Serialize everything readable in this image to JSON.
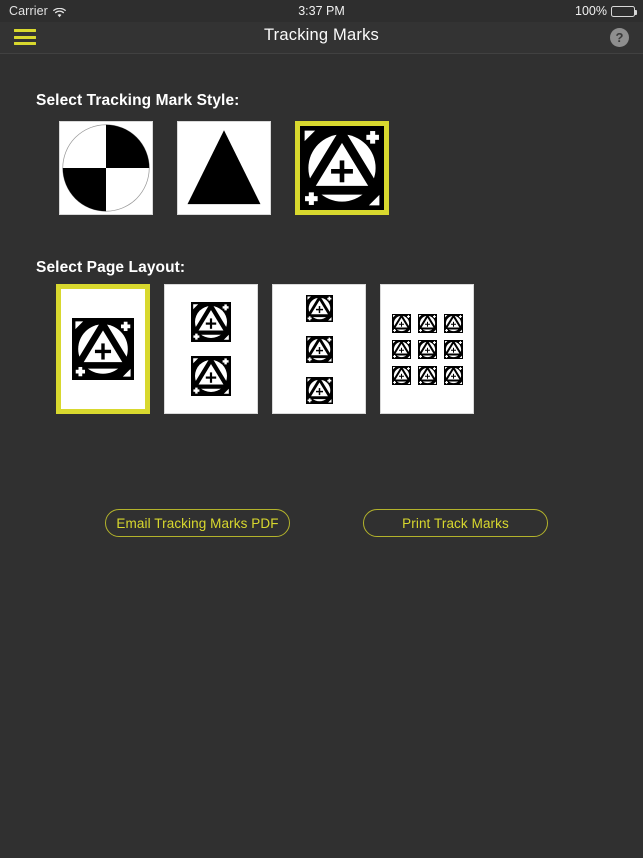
{
  "status_bar": {
    "carrier": "Carrier",
    "wifi_icon": "wifi-icon",
    "time": "3:37 PM",
    "battery_percent": "100%",
    "battery_icon": "battery-full-icon"
  },
  "nav_bar": {
    "title": "Tracking Marks",
    "menu_icon": "hamburger-menu-icon",
    "help_icon": "help-question-icon",
    "help_label": "?"
  },
  "colors": {
    "background": "#303030",
    "navbar": "#333333",
    "accent_yellow": "#d8d82e",
    "accent_yellow_dim": "#b3b32b",
    "text_primary": "#ffffff",
    "mark_black": "#000000",
    "paper_white": "#ffffff"
  },
  "style_section": {
    "label": "Select Tracking Mark Style:",
    "selected_index": 2,
    "options": [
      {
        "id": "quadrant-circle",
        "name": "quadrant-circle-mark",
        "selected": false
      },
      {
        "id": "solid-triangle",
        "name": "solid-triangle-mark",
        "selected": false
      },
      {
        "id": "circle-triangle-crosses",
        "name": "circle-triangle-cross-mark",
        "selected": true
      }
    ]
  },
  "layout_section": {
    "label": "Select Page Layout:",
    "selected_index": 0,
    "options": [
      {
        "id": "layout-1-up",
        "name": "page-layout-1-up",
        "marks": 1,
        "rows": 1,
        "cols": 1,
        "mark_size": 62,
        "selected": true
      },
      {
        "id": "layout-2-up",
        "name": "page-layout-2-up",
        "marks": 2,
        "rows": 2,
        "cols": 1,
        "mark_size": 40,
        "selected": false
      },
      {
        "id": "layout-3-up",
        "name": "page-layout-3-up",
        "marks": 3,
        "rows": 3,
        "cols": 1,
        "mark_size": 27,
        "selected": false
      },
      {
        "id": "layout-9-up",
        "name": "page-layout-9-up",
        "marks": 9,
        "rows": 3,
        "cols": 3,
        "mark_size": 19,
        "selected": false
      }
    ]
  },
  "actions": {
    "email_label": "Email Tracking Marks PDF",
    "print_label": "Print Track Marks"
  }
}
